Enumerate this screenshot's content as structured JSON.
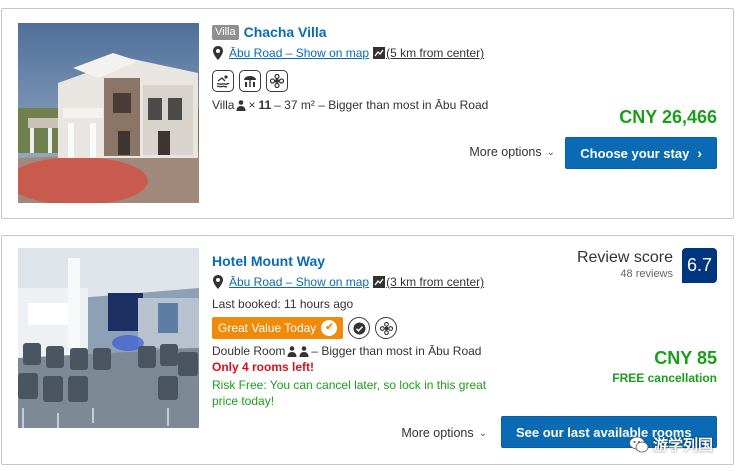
{
  "listings": [
    {
      "type_badge": "Villa",
      "name": "Chacha Villa",
      "location_link": "Ābu Road – Show on map",
      "distance": "(5 km from center)",
      "facility_icons": [
        "swimming-pool-icon",
        "beach-umbrella-icon",
        "spa-flower-icon"
      ],
      "room_type": "Villa",
      "room_multiplier": "×",
      "room_count": "11",
      "room_size": "– 37 m² – Bigger than most in Ābu Road",
      "price": "CNY 26,466",
      "more_options": "More options",
      "cta": "Choose your stay"
    },
    {
      "name": "Hotel Mount Way",
      "location_link": "Ābu Road – Show on map",
      "distance": "(3 km from center)",
      "review_label": "Review score",
      "review_count": "48 reviews",
      "review_score": "6.7",
      "last_booked": "Last booked: 11 hours ago",
      "badge": "Great Value Today",
      "room_type": "Double Room",
      "room_note": "– Bigger than most in Ābu Road",
      "urgency": "Only 4 rooms left!",
      "risk_free": "Risk Free: You can cancel later, so lock in this great price today!",
      "price": "CNY 85",
      "cancellation": "FREE cancellation",
      "more_options": "More options",
      "cta": "See our last available rooms"
    }
  ],
  "watermark": "游学列国",
  "colors": {
    "link": "#0a6ab3",
    "price_green": "#1b9e1b",
    "cta_blue": "#0a6ab3",
    "score_navy": "#003580",
    "badge_orange": "#f08a0b",
    "urgent_red": "#d4111e"
  }
}
